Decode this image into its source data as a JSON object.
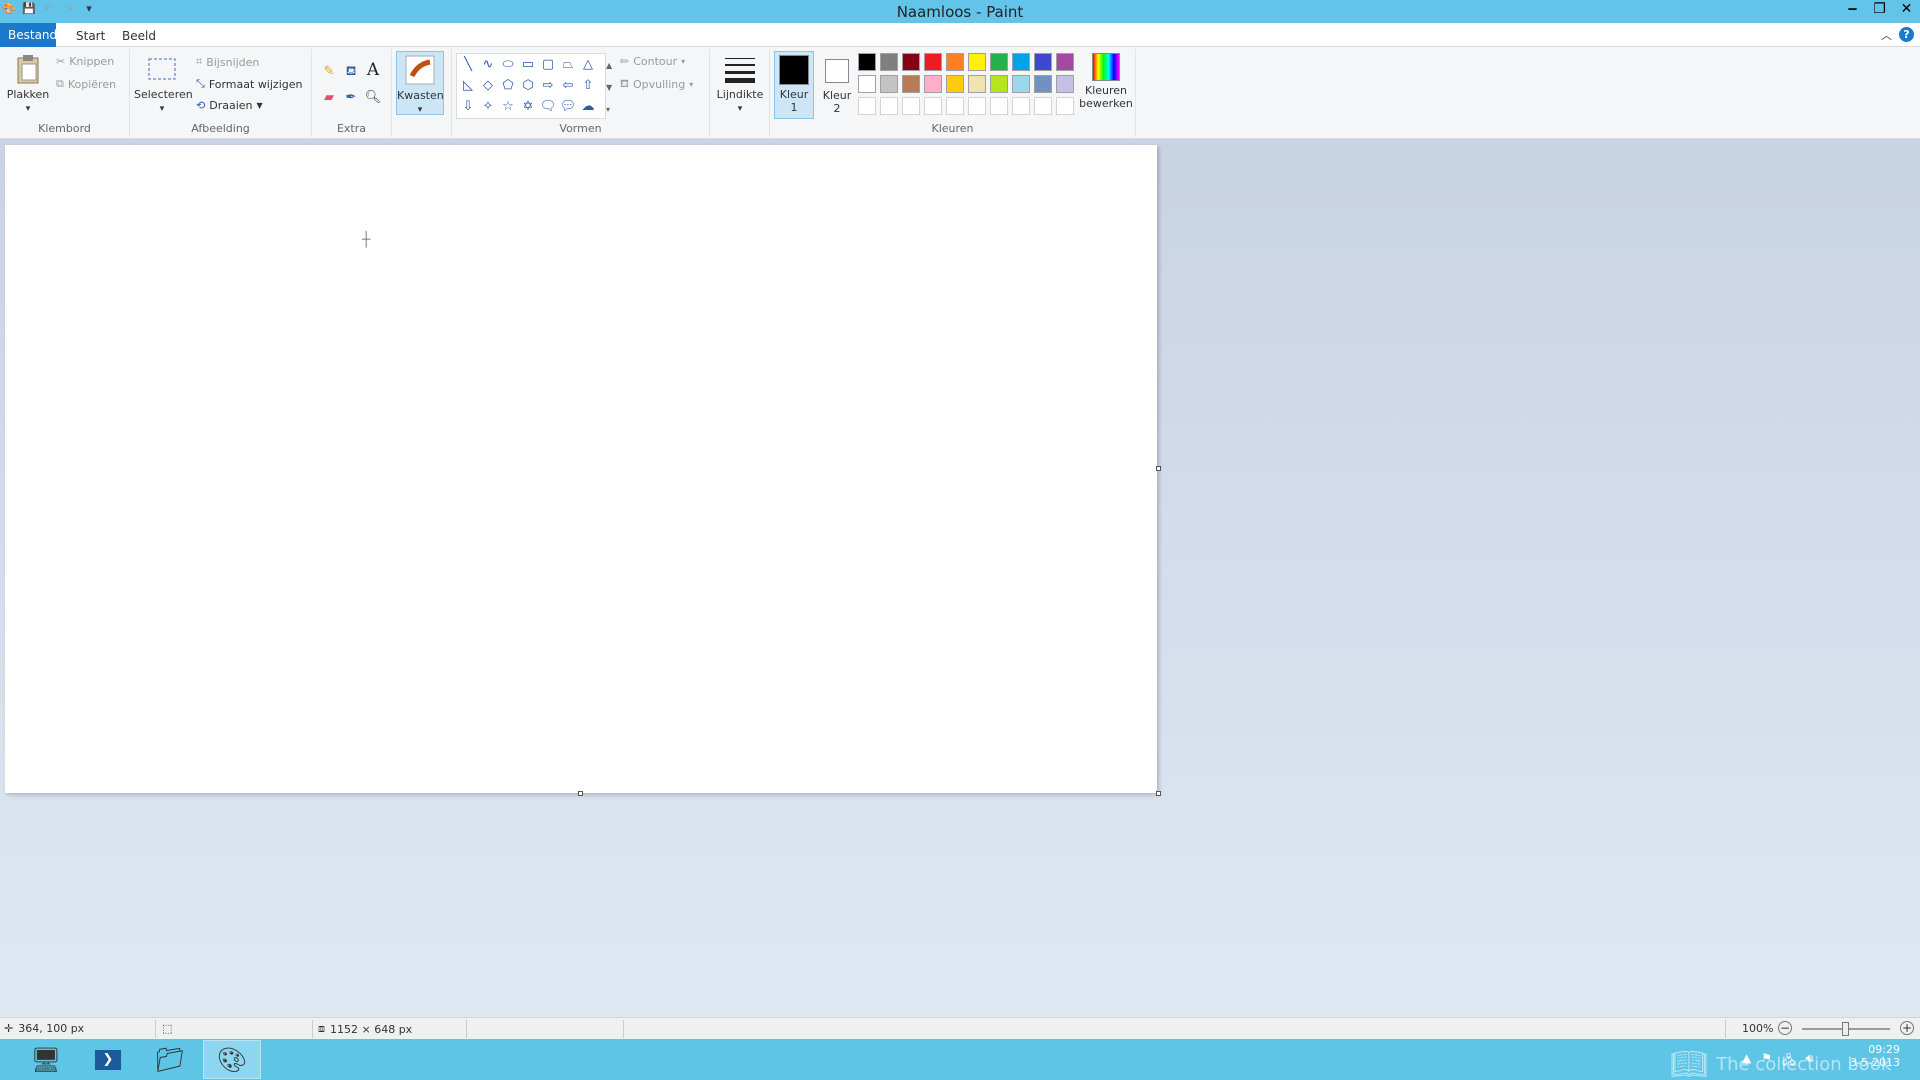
{
  "window": {
    "title": "Naamloos - Paint"
  },
  "tabs": [
    {
      "label": "Bestand"
    },
    {
      "label": "Start"
    },
    {
      "label": "Beeld"
    }
  ],
  "ribbon": {
    "clipboard": {
      "paste": "Plakken",
      "cut": "Knippen",
      "copy": "Kopiëren",
      "label": "Klembord"
    },
    "image": {
      "select": "Selecteren",
      "crop": "Bijsnijden",
      "resize": "Formaat wijzigen",
      "rotate": "Draaien",
      "label": "Afbeelding"
    },
    "tools": {
      "label": "Extra"
    },
    "brushes": {
      "label": "Kwasten"
    },
    "shapes": {
      "outline": "Contour",
      "fill": "Opvulling",
      "label": "Vormen"
    },
    "size": {
      "label": "Lijndikte"
    },
    "colors": {
      "color1": "Kleur 1",
      "color2": "Kleur 2",
      "edit": "Kleuren bewerken",
      "label": "Kleuren",
      "palette_row1": [
        "#000000",
        "#7f7f7f",
        "#880015",
        "#ed1c24",
        "#ff7f27",
        "#fff200",
        "#22b14c",
        "#00a2e8",
        "#3f48cc",
        "#a349a4"
      ],
      "palette_row2": [
        "#ffffff",
        "#c3c3c3",
        "#b97a57",
        "#ffaec9",
        "#ffc90e",
        "#efe4b0",
        "#b5e61d",
        "#99d9ea",
        "#7092be",
        "#c8bfe7"
      ]
    }
  },
  "status": {
    "cursor_pos": "364, 100 px",
    "canvas_size": "1152 × 648 px",
    "zoom": "100%"
  },
  "tray": {
    "time": "09:29",
    "date": "3-5-2013",
    "watermark": "The collection book"
  }
}
